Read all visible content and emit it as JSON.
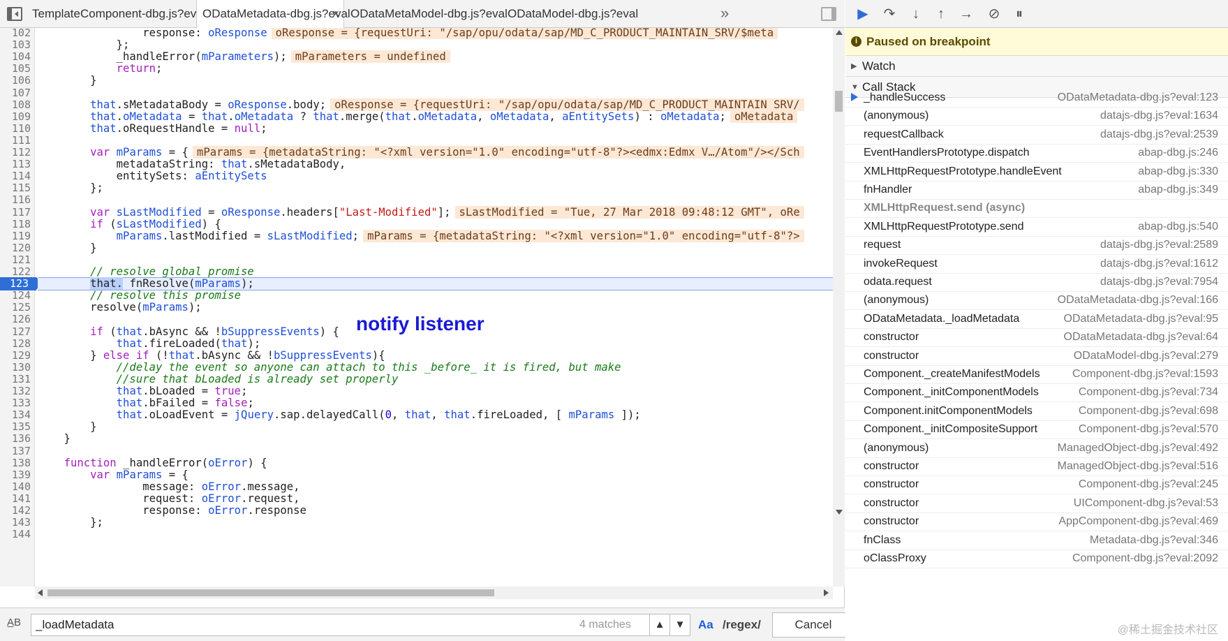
{
  "tabs": [
    {
      "label": "TemplateComponent-dbg.js?eval"
    },
    {
      "label": "ODataMetadata-dbg.js?eval"
    },
    {
      "label": "ODataMetaModel-dbg.js?eval"
    },
    {
      "label": "ODataModel-dbg.js?eval"
    }
  ],
  "tab_close": "×",
  "tab_more": "»",
  "annotation": "notify listener",
  "lines": {
    "102": {
      "n": "102"
    },
    "103": {
      "n": "103"
    },
    "104": {
      "n": "104"
    },
    "105": {
      "n": "105"
    },
    "106": {
      "n": "106"
    },
    "107": {
      "n": "107"
    },
    "108": {
      "n": "108"
    },
    "109": {
      "n": "109"
    },
    "110": {
      "n": "110"
    },
    "111": {
      "n": "111"
    },
    "112": {
      "n": "112"
    },
    "113": {
      "n": "113"
    },
    "114": {
      "n": "114"
    },
    "115": {
      "n": "115"
    },
    "116": {
      "n": "116"
    },
    "117": {
      "n": "117"
    },
    "118": {
      "n": "118"
    },
    "119": {
      "n": "119"
    },
    "120": {
      "n": "120"
    },
    "121": {
      "n": "121"
    },
    "122": {
      "n": "122"
    },
    "123": {
      "n": "123"
    },
    "124": {
      "n": "124"
    },
    "125": {
      "n": "125"
    },
    "126": {
      "n": "126"
    },
    "127": {
      "n": "127"
    },
    "128": {
      "n": "128"
    },
    "129": {
      "n": "129"
    },
    "130": {
      "n": "130"
    },
    "131": {
      "n": "131"
    },
    "132": {
      "n": "132"
    },
    "133": {
      "n": "133"
    },
    "134": {
      "n": "134"
    },
    "135": {
      "n": "135"
    },
    "136": {
      "n": "136"
    },
    "137": {
      "n": "137"
    },
    "138": {
      "n": "138"
    },
    "139": {
      "n": "139"
    },
    "140": {
      "n": "140"
    },
    "141": {
      "n": "141"
    },
    "142": {
      "n": "142"
    },
    "143": {
      "n": "143"
    },
    "144": {
      "n": "144"
    }
  },
  "code": {
    "l102": "                response: oResponse",
    "l102_inline": "oResponse = {requestUri: \"/sap/opu/odata/sap/MD_C_PRODUCT_MAINTAIN_SRV/$meta",
    "l103": "            };",
    "l104": "            _handleError(mParameters);",
    "l104_inline": "mParameters = undefined",
    "l105": "            return;",
    "l106": "        }",
    "l108": "        that.sMetadataBody = oResponse.body;",
    "l108_inline": "oResponse = {requestUri: \"/sap/opu/odata/sap/MD_C_PRODUCT_MAINTAIN_SRV/",
    "l109": "        that.oMetadata = that.oMetadata ? that.merge(that.oMetadata, oMetadata, aEntitySets) : oMetadata;",
    "l109_inline": "oMetadata",
    "l110": "        that.oRequestHandle = null;",
    "l112": "        var mParams = {",
    "l112_inline": "mParams = {metadataString: \"<?xml version=\"1.0\" encoding=\"utf-8\"?><edmx:Edmx V…/Atom\"/></Sch",
    "l113": "            metadataString: that.sMetadataBody,",
    "l114": "            entitySets: aEntitySets",
    "l115": "        };",
    "l117": "        var sLastModified = oResponse.headers[\"Last-Modified\"];",
    "l117_inline": "sLastModified = \"Tue, 27 Mar 2018 09:48:12 GMT\", oRe",
    "l118": "        if (sLastModified) {",
    "l119": "            mParams.lastModified = sLastModified;",
    "l119_inline": "mParams = {metadataString: \"<?xml version=\"1.0\" encoding=\"utf-8\"?>",
    "l120": "        }",
    "l122": "        // resolve global promise",
    "l123a": "        ",
    "l123b": "that.",
    "l123c": " fnResolve(mParams);",
    "l124": "        // resolve this promise",
    "l125": "        resolve(mParams);",
    "l127": "        if (that.bAsync && !bSuppressEvents) {",
    "l128": "            that.fireLoaded(that);",
    "l129": "        } else if (!that.bAsync && !bSuppressEvents){",
    "l130": "            //delay the event so anyone can attach to this _before_ it is fired, but make",
    "l131": "            //sure that bLoaded is already set properly",
    "l132": "            that.bLoaded = true;",
    "l133": "            that.bFailed = false;",
    "l134": "            that.oLoadEvent = jQuery.sap.delayedCall(0, that, that.fireLoaded, [ mParams ]);",
    "l135": "        }",
    "l136": "    }",
    "l138": "    function _handleError(oError) {",
    "l139": "        var mParams = {",
    "l140": "                message: oError.message,",
    "l141": "                request: oError.request,",
    "l142": "                response: oError.response",
    "l143": "        };"
  },
  "search": {
    "icon": "A̲B",
    "value": "_loadMetadata",
    "matches": "4 matches",
    "prev": "▲",
    "next": "▼",
    "match_case": "Aa",
    "regex": "/regex/",
    "cancel": "Cancel"
  },
  "debugger": {
    "paused_text": "Paused on breakpoint",
    "paused_icon": "i",
    "watch_label": "Watch",
    "callstack_label": "Call Stack",
    "frames": [
      {
        "fn": "_handleSuccess",
        "loc": "ODataMetadata-dbg.js?eval:123"
      },
      {
        "fn": "(anonymous)",
        "loc": "datajs-dbg.js?eval:1634"
      },
      {
        "fn": "requestCallback",
        "loc": "datajs-dbg.js?eval:2539"
      },
      {
        "fn": "EventHandlersPrototype.dispatch",
        "loc": "abap-dbg.js:246"
      },
      {
        "fn": "XMLHttpRequestPrototype.handleEvent",
        "loc": "abap-dbg.js:330"
      },
      {
        "fn": "fnHandler",
        "loc": "abap-dbg.js:349"
      },
      {
        "fn": "XMLHttpRequest.send (async)",
        "loc": ""
      },
      {
        "fn": "XMLHttpRequestPrototype.send",
        "loc": "abap-dbg.js:540"
      },
      {
        "fn": "request",
        "loc": "datajs-dbg.js?eval:2589"
      },
      {
        "fn": "invokeRequest",
        "loc": "datajs-dbg.js?eval:1612"
      },
      {
        "fn": "odata.request",
        "loc": "datajs-dbg.js?eval:7954"
      },
      {
        "fn": "(anonymous)",
        "loc": "ODataMetadata-dbg.js?eval:166"
      },
      {
        "fn": "ODataMetadata._loadMetadata",
        "loc": "ODataMetadata-dbg.js?eval:95"
      },
      {
        "fn": "constructor",
        "loc": "ODataMetadata-dbg.js?eval:64"
      },
      {
        "fn": "constructor",
        "loc": "ODataModel-dbg.js?eval:279"
      },
      {
        "fn": "Component._createManifestModels",
        "loc": "Component-dbg.js?eval:1593"
      },
      {
        "fn": "Component._initComponentModels",
        "loc": "Component-dbg.js?eval:734"
      },
      {
        "fn": "Component.initComponentModels",
        "loc": "Component-dbg.js?eval:698"
      },
      {
        "fn": "Component._initCompositeSupport",
        "loc": "Component-dbg.js?eval:570"
      },
      {
        "fn": "(anonymous)",
        "loc": "ManagedObject-dbg.js?eval:492"
      },
      {
        "fn": "constructor",
        "loc": "ManagedObject-dbg.js?eval:516"
      },
      {
        "fn": "constructor",
        "loc": "Component-dbg.js?eval:245"
      },
      {
        "fn": "constructor",
        "loc": "UIComponent-dbg.js?eval:53"
      },
      {
        "fn": "constructor",
        "loc": "AppComponent-dbg.js?eval:469"
      },
      {
        "fn": "fnClass",
        "loc": "Metadata-dbg.js?eval:346"
      },
      {
        "fn": "oClassProxy",
        "loc": "Component-dbg.js?eval:2092"
      }
    ]
  },
  "watermark": "@稀土掘金技术社区",
  "colors": {
    "accent": "#2f6ed6",
    "annotation": "#1a1ad6",
    "paused_bg": "#fffbd9"
  }
}
